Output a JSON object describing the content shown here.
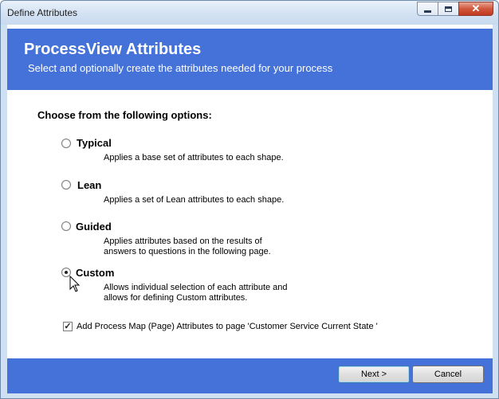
{
  "window": {
    "title": "Define Attributes",
    "minimize_label": "minimize",
    "maximize_label": "maximize",
    "close_label": "close"
  },
  "header": {
    "title": "ProcessView Attributes",
    "subtitle": "Select and optionally create the attributes needed for your process"
  },
  "options_heading": "Choose from the following options:",
  "options": [
    {
      "label": "Typical",
      "description": [
        "Applies a base set of attributes to each shape."
      ],
      "selected": false
    },
    {
      "label": "Lean",
      "description": [
        "Applies a set of Lean attributes to each shape."
      ],
      "selected": false
    },
    {
      "label": "Guided",
      "description": [
        "Applies attributes based on the results of",
        "answers to questions in the following page."
      ],
      "selected": false
    },
    {
      "label": "Custom",
      "description": [
        "Allows individual selection of each attribute and",
        "allows for defining Custom attributes."
      ],
      "selected": true
    }
  ],
  "page_attributes_checkbox": {
    "label": "Add Process Map (Page) Attributes to page 'Customer Service Current State   '",
    "checked": true
  },
  "buttons": {
    "next": "Next >",
    "cancel": "Cancel"
  },
  "colors": {
    "banner": "#4472d9",
    "title_bar": "#d3e2f3",
    "close_button": "#c23a1f"
  },
  "icons": {
    "cursor": "arrow-cursor-icon",
    "checkmark": "check-icon"
  }
}
